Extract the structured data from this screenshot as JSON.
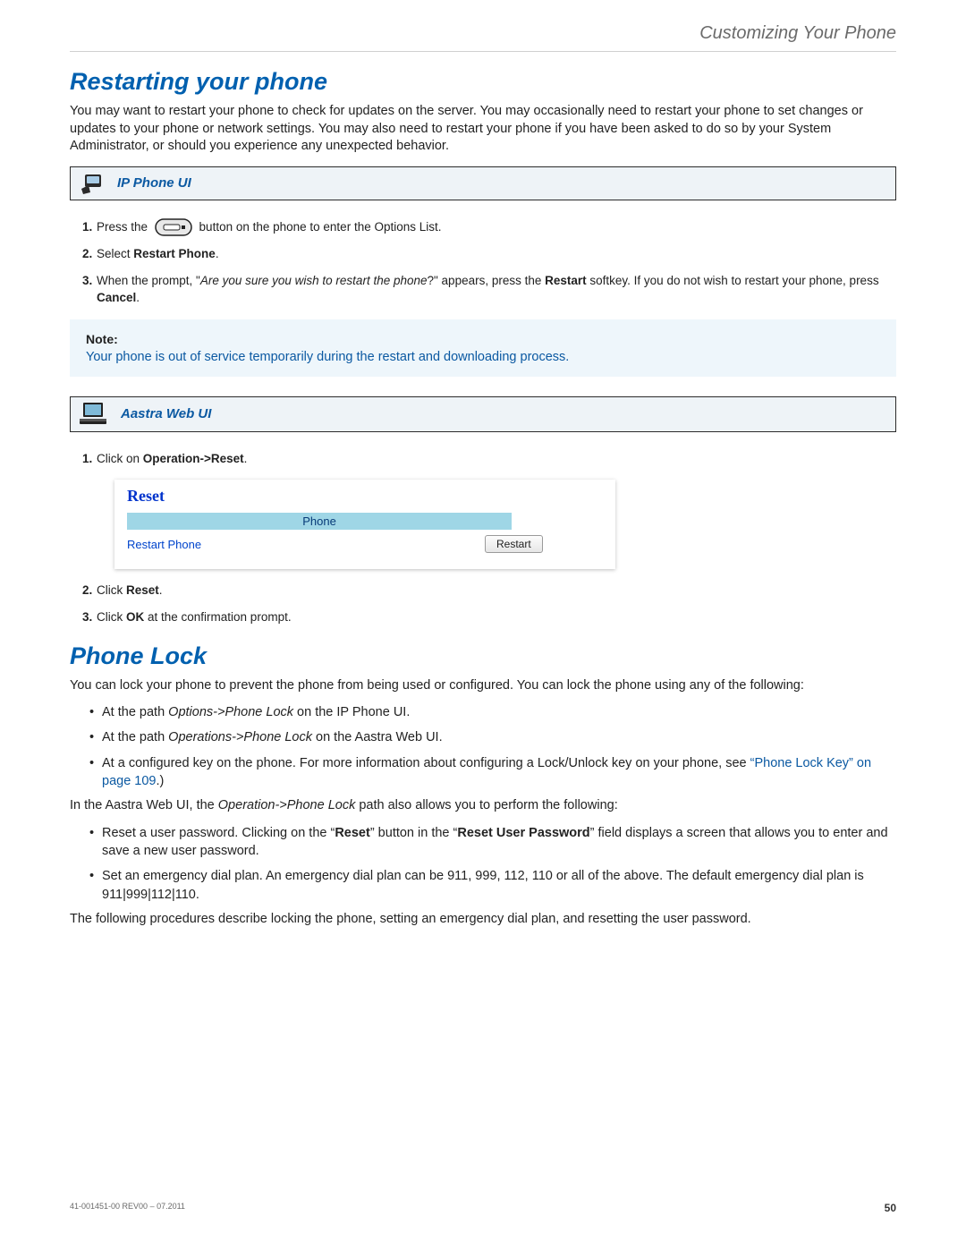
{
  "header": {
    "breadcrumb": "Customizing Your Phone"
  },
  "section1": {
    "title": "Restarting your phone",
    "intro": "You may want to restart your phone to check for updates on the server. You may occasionally need to restart your phone to set changes or updates to your phone or network settings.   You may also need to restart your phone if you have been asked to do so by your System Administrator, or should you experience any unexpected behavior.",
    "ipphone_label": "IP Phone UI",
    "steps_ip": {
      "s1": {
        "num": "1.",
        "pre": "Press the ",
        "post": " button on the phone to enter the Options List."
      },
      "s2": {
        "num": "2.",
        "pre": "Select ",
        "bold": "Restart Phone",
        "post": "."
      },
      "s3": {
        "num": "3.",
        "pre": "When the prompt, \"",
        "ital": "Are you sure you wish to restart the phone",
        "mid": "?\" appears, press the ",
        "bold1": "Restart",
        "mid2": " softkey. If you do not wish to restart your phone, press ",
        "bold2": "Cancel",
        "post": "."
      }
    },
    "note": {
      "head": "Note:",
      "body": "Your phone is out of service temporarily during the restart and downloading process."
    },
    "webui_label": "Aastra Web UI",
    "steps_web": {
      "s1": {
        "num": "1.",
        "pre": "Click on ",
        "bold": "Operation->Reset",
        "post": "."
      },
      "s2": {
        "num": "2.",
        "pre": "Click ",
        "bold": "Reset",
        "post": "."
      },
      "s3": {
        "num": "3.",
        "pre": "Click ",
        "bold": "OK",
        "post": " at the confirmation prompt."
      }
    },
    "web_shot": {
      "title": "Reset",
      "head": "Phone",
      "row_label": "Restart Phone",
      "row_button": "Restart"
    }
  },
  "section2": {
    "title": "Phone Lock",
    "intro": "You can lock your phone to prevent the phone from being used or configured. You can lock the phone using any of the following:",
    "bullets1": {
      "b1": {
        "pre": "At the path ",
        "ital": "Options->Phone Lock",
        "post": " on the IP Phone UI."
      },
      "b2": {
        "pre": "At the path ",
        "ital": "Operations->Phone Lock",
        "post": " on the Aastra Web UI."
      },
      "b3": {
        "pre": "At a configured key on the phone. For more information about configuring a Lock/Unlock key on your phone, see ",
        "link1": "“Phone Lock Key” on ",
        "link2": "page 109",
        "post": ".)"
      }
    },
    "mid": {
      "pre": "In the Aastra Web UI, the ",
      "ital": "Operation->Phone Lock",
      "post": " path also allows you to perform the following:"
    },
    "bullets2": {
      "b1": {
        "pre": "Reset a user password. Clicking on the “",
        "bold1": "Reset",
        "mid": "” button in the “",
        "bold2": "Reset User Password",
        "post": "” field displays a screen that allows you to enter and save a new user password."
      },
      "b2": {
        "text": "Set an emergency dial plan. An emergency dial plan can be 911, 999, 112, 110 or all of the above. The default emergency dial plan is 911|999|112|110."
      }
    },
    "outro": "The following procedures describe locking the phone, setting an emergency dial plan, and resetting the user password."
  },
  "footer": {
    "docid": "41-001451-00 REV00 – 07.2011",
    "page": "50"
  }
}
